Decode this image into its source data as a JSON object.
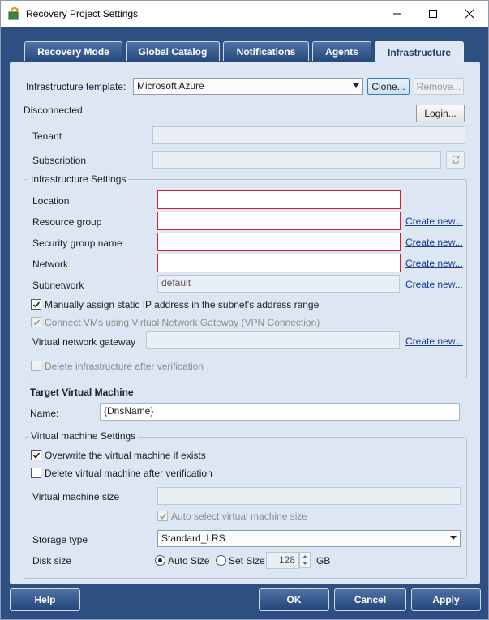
{
  "window": {
    "title": "Recovery Project Settings"
  },
  "tabs": [
    {
      "label": "Recovery Mode"
    },
    {
      "label": "Global Catalog"
    },
    {
      "label": "Notifications"
    },
    {
      "label": "Agents"
    },
    {
      "label": "Infrastructure"
    }
  ],
  "template": {
    "label": "Infrastructure template:",
    "value": "Microsoft Azure",
    "clone_label": "Clone...",
    "remove_label": "Remove..."
  },
  "connection": {
    "status": "Disconnected",
    "login_label": "Login..."
  },
  "tenant": {
    "label": "Tenant",
    "value": ""
  },
  "subscription": {
    "label": "Subscription",
    "value": ""
  },
  "infra_settings": {
    "title": "Infrastructure Settings",
    "location": {
      "label": "Location",
      "value": ""
    },
    "resource_group": {
      "label": "Resource group",
      "value": "",
      "create": "Create new..."
    },
    "security_group": {
      "label": "Security group name",
      "value": "",
      "create": "Create new..."
    },
    "network": {
      "label": "Network",
      "value": "",
      "create": "Create new..."
    },
    "subnetwork": {
      "label": "Subnetwork",
      "value": "default",
      "create": "Create new..."
    },
    "static_ip": {
      "label": "Manually assign static IP address in the subnet's address range",
      "checked": true
    },
    "vpn": {
      "label": "Connect VMs using Virtual Network Gateway (VPN Connection)",
      "checked": true
    },
    "gateway": {
      "label": "Virtual network gateway",
      "value": "",
      "create": "Create new..."
    },
    "delete_infra": {
      "label": "Delete infrastructure after verification",
      "checked": false
    }
  },
  "target_vm": {
    "title": "Target Virtual Machine",
    "name_label": "Name:",
    "name_value": "{DnsName}"
  },
  "vm_settings": {
    "title": "Virtual machine Settings",
    "overwrite": {
      "label": "Overwrite the virtual machine if exists",
      "checked": true
    },
    "delete_vm": {
      "label": "Delete virtual machine after verification",
      "checked": false
    },
    "size": {
      "label": "Virtual machine size",
      "value": ""
    },
    "auto_select": {
      "label": "Auto select virtual machine size",
      "checked": true
    },
    "storage": {
      "label": "Storage type",
      "value": "Standard_LRS"
    },
    "disk": {
      "label": "Disk size",
      "auto_label": "Auto Size",
      "set_label": "Set Size",
      "value": "128",
      "unit": "GB"
    }
  },
  "footer": {
    "help": "Help",
    "ok": "OK",
    "cancel": "Cancel",
    "apply": "Apply"
  },
  "colors": {
    "frame": "#2e4f82",
    "panel": "#dde7f3",
    "error_border": "#d0202a",
    "link": "#1a3d8f"
  }
}
